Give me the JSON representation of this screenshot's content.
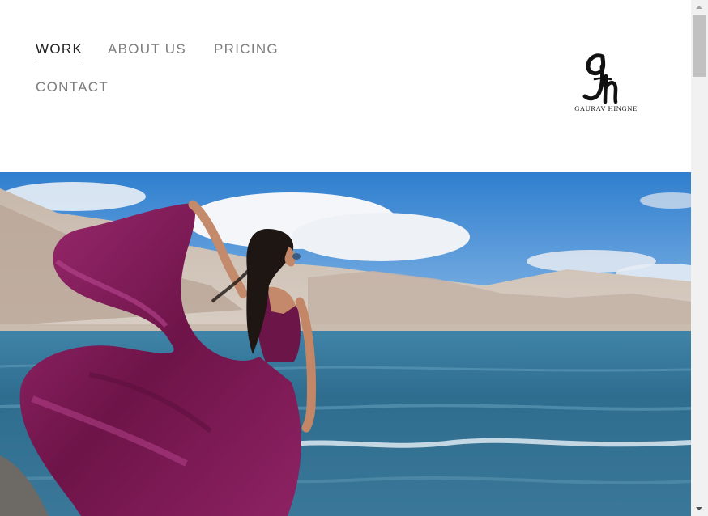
{
  "nav": {
    "items": [
      {
        "label": "WORK",
        "active": true
      },
      {
        "label": "ABOUT US",
        "active": false
      },
      {
        "label": "PRICING",
        "active": false
      },
      {
        "label": "CONTACT",
        "active": false
      }
    ]
  },
  "logo": {
    "text": "GAURAV HINGNE",
    "icon": "gh-monogram-icon"
  },
  "hero": {
    "image": "woman-in-purple-gown-by-lake-photo"
  },
  "colors": {
    "nav_text": "#7d7d7d",
    "nav_active": "#222222",
    "gown": "#7a1a55",
    "lake": "#2f6d8f",
    "sky": "#3d86c9"
  }
}
